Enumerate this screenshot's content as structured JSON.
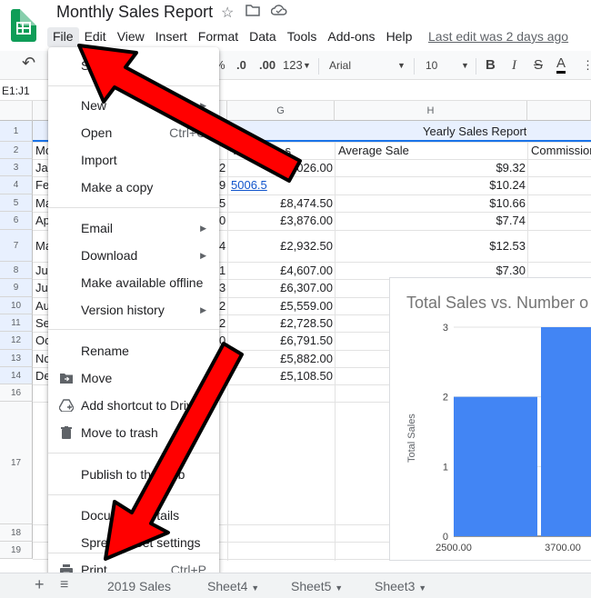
{
  "app": {
    "doc_title": "Monthly Sales Report",
    "last_edit": "Last edit was 2 days ago"
  },
  "menubar": [
    "File",
    "Edit",
    "View",
    "Insert",
    "Format",
    "Data",
    "Tools",
    "Add-ons",
    "Help"
  ],
  "toolbar": {
    "undo": "↶",
    "percent": "%",
    "dec_less": ".0",
    "dec_more": ".00",
    "format_more": "123",
    "font": "Arial",
    "font_size": "10",
    "bold": "B",
    "italic": "I",
    "strike": "S",
    "text_color": "A"
  },
  "formula_bar": {
    "name_box": "E1:J1",
    "fx_text": "t"
  },
  "columns": [
    "G",
    "H"
  ],
  "rows": [
    "1",
    "2",
    "3",
    "4",
    "5",
    "6",
    "7",
    "8",
    "9",
    "10",
    "11",
    "12",
    "13",
    "14",
    "16",
    "17",
    "18",
    "19"
  ],
  "sheet": {
    "h1": "Yearly Sales Report",
    "headers": {
      "a": "Mo",
      "g": "Total",
      "g_suffix": "s",
      "h": "Average Sale",
      "i": "Commission"
    },
    "col_a": [
      "Ja",
      "Fe",
      "Ma",
      "Ap",
      "Ma",
      "Ju",
      "Ju",
      "Au",
      "Se",
      "Oc",
      "No",
      "De"
    ],
    "col_f": [
      "2",
      "9",
      "5",
      "0",
      "4",
      "1",
      "3",
      "2",
      "2",
      "0",
      "0",
      "6"
    ],
    "col_g": [
      "£4,026.00",
      "5006.5",
      "£8,474.50",
      "£3,876.00",
      "£2,932.50",
      "£4,607.00",
      "£6,307.00",
      "£5,559.00",
      "£2,728.50",
      "£6,791.50",
      "£5,882.00",
      "£5,108.50"
    ],
    "col_h": [
      "$9.32",
      "$10.24",
      "$10.66",
      "$7.74",
      "$12.53",
      "$7.30"
    ]
  },
  "file_menu": {
    "share": "Share",
    "new": "New",
    "open": "Open",
    "open_sc": "Ctrl+O",
    "import": "Import",
    "make_copy": "Make a copy",
    "email": "Email",
    "download": "Download",
    "offline": "Make available offline",
    "version": "Version history",
    "rename": "Rename",
    "move": "Move",
    "shortcut": "Add shortcut to Drive",
    "trash": "Move to trash",
    "publish": "Publish to the web",
    "doc_details": "Document details",
    "settings": "Spreadsheet settings",
    "print": "Print",
    "print_sc": "Ctrl+P"
  },
  "chart_data": {
    "type": "bar",
    "title": "Total Sales vs. Number o",
    "ylabel": "Total Sales",
    "yticks": [
      "0",
      "1",
      "2",
      "3"
    ],
    "ylim": [
      0,
      3
    ],
    "categories": [
      "2500.00",
      "3700.00"
    ],
    "values": [
      2,
      3
    ]
  },
  "tabs": [
    "",
    "Sheet4",
    "Sheet5",
    "Sheet3"
  ],
  "tab_labels": {
    "partial": "2019 Sales",
    "add": "+",
    "menu": "≡"
  },
  "colors": {
    "accent_green": "#0f9d58",
    "bar_blue": "#4285f4",
    "arrow_red": "#ff0000"
  }
}
